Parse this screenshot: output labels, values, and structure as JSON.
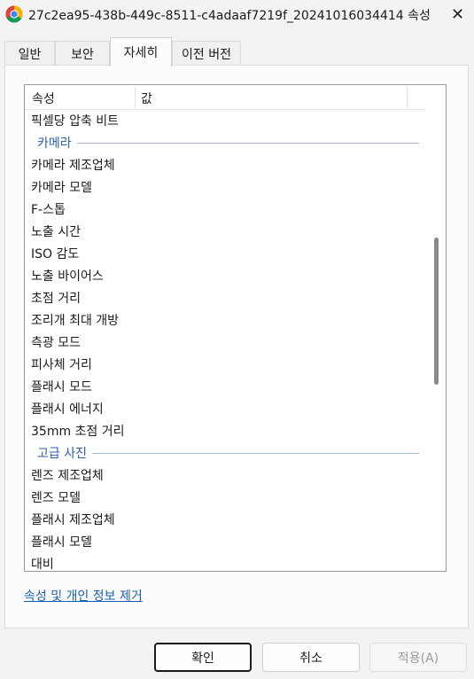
{
  "window": {
    "title": "27c2ea95-438b-449c-8511-c4adaaf7219f_20241016034414 속성",
    "close_glyph": "✕"
  },
  "tabs": [
    {
      "label": "일반"
    },
    {
      "label": "보안"
    },
    {
      "label": "자세히"
    },
    {
      "label": "이전 버전"
    }
  ],
  "active_tab": "자세히",
  "list": {
    "headers": {
      "name": "속성",
      "value": "값"
    },
    "items": [
      {
        "type": "row",
        "label": "픽셀당 압축 비트"
      },
      {
        "type": "group",
        "label": "카메라"
      },
      {
        "type": "row",
        "label": "카메라 제조업체"
      },
      {
        "type": "row",
        "label": "카메라 모델"
      },
      {
        "type": "row",
        "label": "F-스톱"
      },
      {
        "type": "row",
        "label": "노출 시간"
      },
      {
        "type": "row",
        "label": "ISO 감도"
      },
      {
        "type": "row",
        "label": "노출 바이어스"
      },
      {
        "type": "row",
        "label": "초점 거리"
      },
      {
        "type": "row",
        "label": "조리개 최대 개방"
      },
      {
        "type": "row",
        "label": "측광 모드"
      },
      {
        "type": "row",
        "label": "피사체 거리"
      },
      {
        "type": "row",
        "label": "플래시 모드"
      },
      {
        "type": "row",
        "label": "플래시 에너지"
      },
      {
        "type": "row",
        "label": "35mm 초점 거리"
      },
      {
        "type": "group",
        "label": "고급 사진"
      },
      {
        "type": "row",
        "label": "렌즈 제조업체"
      },
      {
        "type": "row",
        "label": "렌즈 모델"
      },
      {
        "type": "row",
        "label": "플래시 제조업체"
      },
      {
        "type": "row",
        "label": "플래시 모델"
      },
      {
        "type": "row",
        "label": "대비"
      }
    ]
  },
  "link": {
    "label": "속성 및 개인 정보 제거"
  },
  "buttons": {
    "ok": "확인",
    "cancel": "취소",
    "apply": "적용(A)"
  },
  "colors": {
    "group_text": "#2f5fa8",
    "link": "#1a5fb4"
  },
  "icons": {
    "app_icon": "chrome-icon",
    "close": "close-icon"
  }
}
